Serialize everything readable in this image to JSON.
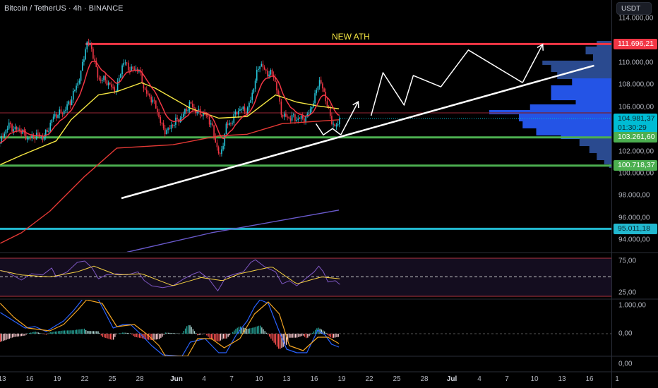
{
  "header": {
    "title": "Bitcoin / TetherUS · 4h · BINANCE"
  },
  "annotations": {
    "ath_text": "NEW ATH"
  },
  "axis": {
    "currency_button": "USDT",
    "price_ticks": [
      "114.000,00",
      "110.000,00",
      "108.000,00",
      "106.000,00",
      "102.000,00",
      "100.000,00",
      "98.000,00",
      "96.000,00",
      "94.000,00"
    ],
    "price_tick_values": [
      114000,
      110000,
      108000,
      106000,
      102000,
      100000,
      98000,
      96000,
      94000
    ],
    "rsi_ticks": [
      "75,00",
      "25,00"
    ],
    "macd_ticks": [
      "1.000,00",
      "0,00"
    ],
    "extra_tick": "0,00",
    "labels": {
      "ath": {
        "text": "111.696,21",
        "value": 111696.21,
        "color": "#f23645"
      },
      "last": {
        "text": "104.981,37",
        "countdown": "01:30:29",
        "value": 104981.37,
        "color": "#00bcd4"
      },
      "support1": {
        "text": "103.261,60",
        "value": 103261.6,
        "color": "#4caf50"
      },
      "support2": {
        "text": "100.718,37",
        "value": 100718.37,
        "color": "#4caf50"
      },
      "support3": {
        "text": "95.011,18",
        "value": 95011.18,
        "color": "#22b8cf"
      }
    }
  },
  "time_axis": {
    "labels": [
      "13",
      "16",
      "19",
      "22",
      "25",
      "28",
      "Jun",
      "4",
      "7",
      "10",
      "13",
      "16",
      "19",
      "22",
      "25",
      "28",
      "Jul",
      "4",
      "7",
      "10",
      "13",
      "16",
      "1"
    ],
    "t": [
      0,
      3,
      6,
      9,
      12,
      15,
      19,
      22,
      25,
      28,
      31,
      34,
      37,
      40,
      43,
      46,
      49,
      52,
      55,
      58,
      61,
      64,
      67
    ],
    "bold": [
      "Jun",
      "Jul"
    ]
  },
  "chart_data": {
    "type": "candlestick",
    "symbol": "BTCUSDT",
    "interval": "4h",
    "time_unit": "days since May 13",
    "ylim": [
      92000,
      115500
    ],
    "colors": {
      "up": "#26c6da",
      "down": "#f23645",
      "ema_fast": "#f23645",
      "ema_mid": "#f5e642",
      "ma_slow": "#e53935",
      "ma_long": "#6a5acd"
    },
    "close_path": [
      [
        -0.2,
        102740
      ],
      [
        0.8,
        104500
      ],
      [
        2.5,
        103400
      ],
      [
        4.4,
        103250
      ],
      [
        5.5,
        104850
      ],
      [
        6.3,
        105500
      ],
      [
        7.5,
        106400
      ],
      [
        8.6,
        109300
      ],
      [
        9.2,
        111700
      ],
      [
        9.8,
        111200
      ],
      [
        10.5,
        108650
      ],
      [
        11.7,
        108000
      ],
      [
        12.5,
        107700
      ],
      [
        13.2,
        109950
      ],
      [
        14,
        109600
      ],
      [
        14.8,
        109300
      ],
      [
        15.5,
        107700
      ],
      [
        16.3,
        106750
      ],
      [
        17.5,
        104200
      ],
      [
        18.2,
        103900
      ],
      [
        19.4,
        105150
      ],
      [
        20.5,
        106100
      ],
      [
        21.7,
        105500
      ],
      [
        22.8,
        104500
      ],
      [
        23.8,
        101300
      ],
      [
        24.4,
        104200
      ],
      [
        25.5,
        105500
      ],
      [
        26.7,
        105800
      ],
      [
        27.5,
        108000
      ],
      [
        28.1,
        109950
      ],
      [
        28.8,
        109300
      ],
      [
        29.6,
        108650
      ],
      [
        30.5,
        105500
      ],
      [
        31.3,
        104850
      ],
      [
        32.5,
        105150
      ],
      [
        33.2,
        104850
      ],
      [
        34,
        106750
      ],
      [
        34.5,
        108650
      ],
      [
        35.2,
        106750
      ],
      [
        35.9,
        104850
      ],
      [
        36.7,
        104000
      ],
      [
        36.85,
        104981
      ]
    ],
    "ma_mid": [
      [
        -0.2,
        100800
      ],
      [
        2.1,
        101650
      ],
      [
        5.9,
        102950
      ],
      [
        7.5,
        104850
      ],
      [
        10.5,
        107100
      ],
      [
        12.5,
        107400
      ],
      [
        15.2,
        108200
      ],
      [
        16.7,
        107700
      ],
      [
        20.5,
        105900
      ],
      [
        23.6,
        105000
      ],
      [
        26.7,
        105150
      ],
      [
        29.8,
        107100
      ],
      [
        32.1,
        106450
      ],
      [
        34.4,
        106100
      ],
      [
        36.7,
        105850
      ]
    ],
    "ma_slow": [
      [
        -0.2,
        93700
      ],
      [
        2.1,
        94650
      ],
      [
        5.2,
        96600
      ],
      [
        9,
        99750
      ],
      [
        12.5,
        102300
      ],
      [
        18.6,
        102600
      ],
      [
        23.6,
        103400
      ],
      [
        26.7,
        103550
      ],
      [
        30.5,
        104500
      ],
      [
        36.7,
        104850
      ]
    ],
    "ma_long": [
      [
        13.6,
        92900
      ],
      [
        22.8,
        94650
      ],
      [
        36.7,
        96700
      ]
    ],
    "levels": [
      {
        "name": "ath",
        "price": 111696.21,
        "color": "#f23645",
        "from_t": 9.1
      },
      {
        "name": "mid-resistance",
        "price": 105480,
        "color": "#7a1f2a",
        "from_t": -1
      },
      {
        "name": "support1",
        "price": 103261.6,
        "color": "#4caf50",
        "from_t": -1
      },
      {
        "name": "support2",
        "price": 100718.37,
        "color": "#4caf50",
        "from_t": -1
      },
      {
        "name": "support3",
        "price": 95011.18,
        "color": "#22b8cf",
        "from_t": -1
      }
    ],
    "trendline": [
      [
        13,
        97770
      ],
      [
        64.5,
        109750
      ]
    ],
    "projection_w": [
      [
        34.2,
        104500
      ],
      [
        35,
        103490
      ],
      [
        36,
        104060
      ],
      [
        36.9,
        103490
      ]
    ],
    "projection_arrow1": [
      [
        36.9,
        103490
      ],
      [
        38.8,
        106490
      ]
    ],
    "projection_zigzag": [
      [
        40.2,
        105220
      ],
      [
        41.5,
        109110
      ],
      [
        43.8,
        106180
      ],
      [
        44.8,
        108850
      ],
      [
        47.8,
        107830
      ],
      [
        50.8,
        111150
      ],
      [
        56.7,
        108210
      ]
    ],
    "projection_arrow2": [
      [
        56.7,
        108210
      ],
      [
        58.9,
        111670
      ]
    ],
    "volume_profile": {
      "value_area": [
        103000,
        108500
      ],
      "colors": {
        "value_area": "#2454e6",
        "outside": "#2a4a8f"
      },
      "levels": [
        [
          111720,
          0.13
        ],
        [
          111210,
          0.22
        ],
        [
          110570,
          0.16
        ],
        [
          109940,
          0.57
        ],
        [
          109620,
          0.5
        ],
        [
          108980,
          0.45
        ],
        [
          108340,
          0.33
        ],
        [
          107710,
          0.5
        ],
        [
          107070,
          0.5
        ],
        [
          106430,
          0.3
        ],
        [
          105990,
          0.67
        ],
        [
          105480,
          1.0
        ],
        [
          105160,
          0.76
        ],
        [
          104520,
          0.73
        ],
        [
          103890,
          0.62
        ],
        [
          103250,
          0.42
        ],
        [
          102930,
          0.27
        ],
        [
          102290,
          0.19
        ],
        [
          101660,
          0.13
        ],
        [
          101020,
          0.07
        ],
        [
          100640,
          0.03
        ]
      ]
    },
    "rsi": {
      "ylim": [
        0,
        100
      ],
      "bands": [
        75,
        25
      ],
      "line": [
        [
          -0.2,
          60
        ],
        [
          0.5,
          58
        ],
        [
          2.1,
          45
        ],
        [
          3.2,
          55
        ],
        [
          4.4,
          53
        ],
        [
          5.4,
          64
        ],
        [
          5.9,
          50
        ],
        [
          7.1,
          58
        ],
        [
          8.2,
          73
        ],
        [
          9,
          75
        ],
        [
          9.8,
          64
        ],
        [
          10.5,
          47
        ],
        [
          11.3,
          53
        ],
        [
          12.5,
          55
        ],
        [
          13.6,
          53
        ],
        [
          14.8,
          58
        ],
        [
          15.5,
          44
        ],
        [
          16.3,
          36
        ],
        [
          17.5,
          33
        ],
        [
          18.6,
          36
        ],
        [
          19.8,
          47
        ],
        [
          20.9,
          55
        ],
        [
          21.5,
          58
        ],
        [
          22.5,
          47
        ],
        [
          23.5,
          28
        ],
        [
          24.4,
          50
        ],
        [
          25.5,
          55
        ],
        [
          26.3,
          58
        ],
        [
          27.1,
          73
        ],
        [
          27.6,
          77
        ],
        [
          28.6,
          66
        ],
        [
          29.8,
          58
        ],
        [
          30.5,
          39
        ],
        [
          31.3,
          44
        ],
        [
          32.1,
          36
        ],
        [
          32.8,
          44
        ],
        [
          34,
          58
        ],
        [
          34.5,
          67
        ],
        [
          35,
          58
        ],
        [
          35.5,
          42
        ],
        [
          36.3,
          44
        ],
        [
          36.8,
          38
        ]
      ],
      "signal": [
        [
          -0.2,
          60
        ],
        [
          2.1,
          53
        ],
        [
          5.2,
          50
        ],
        [
          8.2,
          58
        ],
        [
          10,
          67
        ],
        [
          12.5,
          53
        ],
        [
          15.2,
          55
        ],
        [
          18.6,
          36
        ],
        [
          21.7,
          49
        ],
        [
          24,
          44
        ],
        [
          25.9,
          55
        ],
        [
          29.4,
          66
        ],
        [
          32.1,
          39
        ],
        [
          34.8,
          50
        ],
        [
          36.8,
          47
        ]
      ]
    },
    "macd": {
      "line": [
        [
          -0.2,
          750
        ],
        [
          0.9,
          525
        ],
        [
          2.5,
          200
        ],
        [
          3.6,
          250
        ],
        [
          4.8,
          75
        ],
        [
          5.8,
          275
        ],
        [
          6.7,
          450
        ],
        [
          7.8,
          825
        ],
        [
          8.6,
          1150
        ],
        [
          9,
          1325
        ],
        [
          10.5,
          1200
        ],
        [
          11.3,
          700
        ],
        [
          12.1,
          200
        ],
        [
          13.2,
          325
        ],
        [
          14,
          325
        ],
        [
          15.2,
          -50
        ],
        [
          16.3,
          -425
        ],
        [
          17.5,
          -750
        ],
        [
          19.6,
          -800
        ],
        [
          20.5,
          -300
        ],
        [
          22.1,
          -175
        ],
        [
          23.6,
          -675
        ],
        [
          24.4,
          -675
        ],
        [
          25.5,
          -50
        ],
        [
          26.7,
          450
        ],
        [
          27.5,
          950
        ],
        [
          28.1,
          1200
        ],
        [
          29,
          1075
        ],
        [
          30.2,
          75
        ],
        [
          31,
          -550
        ],
        [
          32.1,
          -675
        ],
        [
          33.2,
          -675
        ],
        [
          34.4,
          125
        ],
        [
          35.2,
          -50
        ],
        [
          35.9,
          -375
        ],
        [
          36.7,
          -475
        ]
      ],
      "signal": [
        [
          -0.2,
          1075
        ],
        [
          1.3,
          575
        ],
        [
          2.8,
          200
        ],
        [
          5.2,
          100
        ],
        [
          6.7,
          325
        ],
        [
          8.2,
          825
        ],
        [
          9.2,
          1200
        ],
        [
          10.9,
          1075
        ],
        [
          12.5,
          250
        ],
        [
          14.4,
          325
        ],
        [
          15.9,
          -50
        ],
        [
          17.1,
          -425
        ],
        [
          17.8,
          -800
        ],
        [
          20.2,
          -800
        ],
        [
          21.3,
          -175
        ],
        [
          22.8,
          -175
        ],
        [
          24.2,
          -500
        ],
        [
          25.9,
          -175
        ],
        [
          27.5,
          700
        ],
        [
          29,
          1125
        ],
        [
          30.2,
          700
        ],
        [
          31.3,
          -425
        ],
        [
          32.8,
          -600
        ],
        [
          34.4,
          -125
        ],
        [
          35.5,
          -125
        ],
        [
          36.7,
          -350
        ]
      ]
    }
  }
}
